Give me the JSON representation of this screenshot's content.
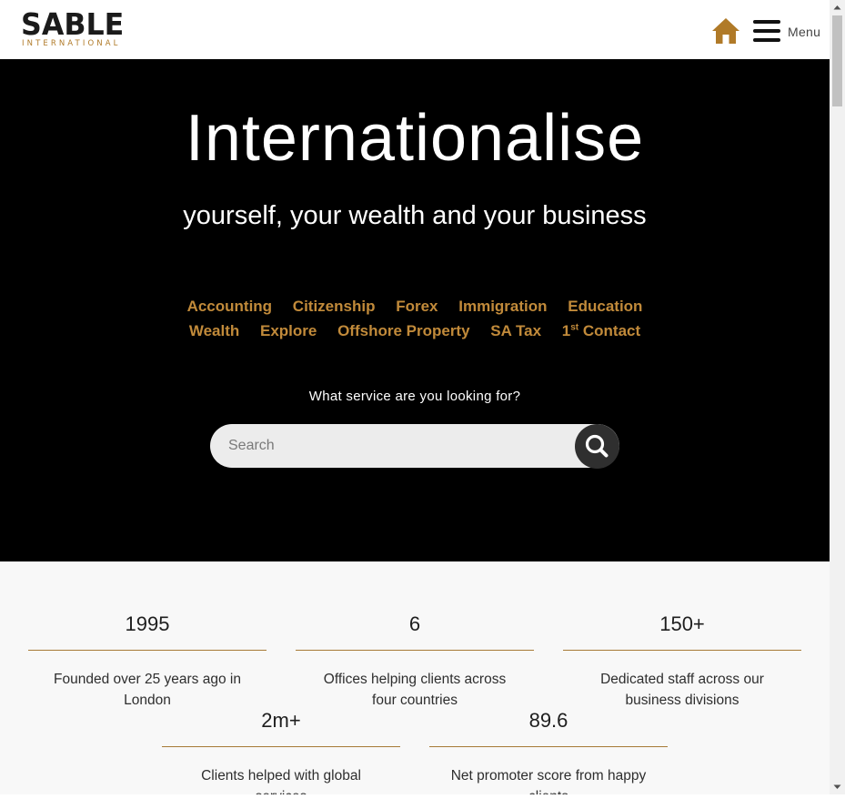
{
  "header": {
    "logo_main": "SABLE",
    "logo_sub": "INTERNATIONAL",
    "menu_label": "Menu",
    "home_icon": "home-icon",
    "menu_icon": "hamburger-icon"
  },
  "hero": {
    "title": "Internationalise",
    "subtitle": "yourself, your wealth and your business",
    "services_row1": [
      "Accounting",
      "Citizenship",
      "Forex",
      "Immigration",
      "Education"
    ],
    "services_row2": [
      "Wealth",
      "Explore",
      "Offshore Property",
      "SA Tax"
    ],
    "first_contact": {
      "num": "1",
      "sup": "st",
      "text": " Contact"
    },
    "search_prompt": "What service are you looking for?",
    "search_placeholder": "Search",
    "search_value": "",
    "search_icon": "search-icon"
  },
  "stats": [
    {
      "value": "1995",
      "description": "Founded over 25 years ago in London"
    },
    {
      "value": "6",
      "description": "Offices helping clients across four countries"
    },
    {
      "value": "150+",
      "description": "Dedicated staff across our business divisions"
    },
    {
      "value": "2m+",
      "description": "Clients helped with global services"
    },
    {
      "value": "89.6",
      "description": "Net promoter score from happy clients"
    }
  ],
  "colors": {
    "accent": "#c18a3a",
    "logo_accent": "#b07a28",
    "hero_bg": "#000000",
    "stats_bg": "#f8f8f8",
    "rule": "#a77a36"
  }
}
